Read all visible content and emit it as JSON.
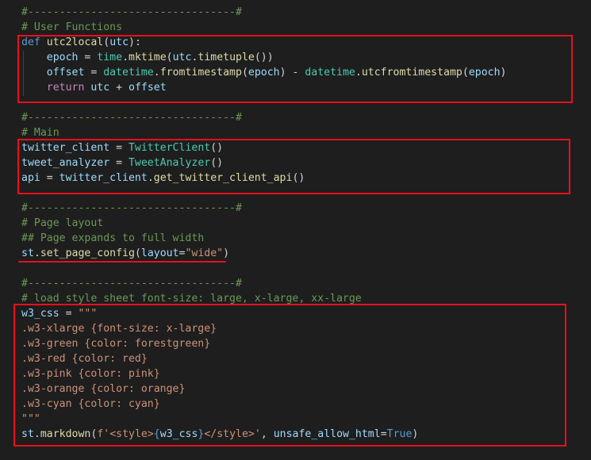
{
  "code": {
    "l1": "#---------------------------------#",
    "l2": "# User Functions",
    "l3a": "def",
    "l3b": " utc2local",
    "l3c": "(",
    "l3d": "utc",
    "l3e": "):",
    "l4a": "    epoch",
    "l4b": " = ",
    "l4c": "time",
    "l4d": ".",
    "l4e": "mktime",
    "l4f": "(",
    "l4g": "utc",
    "l4h": ".",
    "l4i": "timetuple",
    "l4j": "())",
    "l5a": "    offset",
    "l5b": " = ",
    "l5c": "datetime",
    "l5d": ".",
    "l5e": "fromtimestamp",
    "l5f": "(",
    "l5g": "epoch",
    "l5h": ") - ",
    "l5i": "datetime",
    "l5j": ".",
    "l5k": "utcfromtimestamp",
    "l5l": "(",
    "l5m": "epoch",
    "l5n": ")",
    "l6a": "    return",
    "l6b": " utc",
    "l6c": " + ",
    "l6d": "offset",
    "l7": "#---------------------------------#",
    "l8": "# Main",
    "l9a": "twitter_client",
    "l9b": " = ",
    "l9c": "TwitterClient",
    "l9d": "()",
    "l10a": "tweet_analyzer",
    "l10b": " = ",
    "l10c": "TweetAnalyzer",
    "l10d": "()",
    "l11a": "api",
    "l11b": " = ",
    "l11c": "twitter_client",
    "l11d": ".",
    "l11e": "get_twitter_client_api",
    "l11f": "()",
    "l12": "#---------------------------------#",
    "l13": "# Page layout",
    "l14": "## Page expands to full width",
    "l15a": "st",
    "l15b": ".",
    "l15c": "set_page_config",
    "l15d": "(",
    "l15e": "layout",
    "l15f": "=",
    "l15g": "\"wide\"",
    "l15h": ")",
    "l16": "#---------------------------------#",
    "l17": "# load style sheet font-size: large, x-large, xx-large",
    "l18a": "w3_css",
    "l18b": " = ",
    "l18c": "\"\"\"",
    "l19": ".w3-xlarge {font-size: x-large}",
    "l20": ".w3-green {color: forestgreen}",
    "l21": ".w3-red {color: red}",
    "l22": ".w3-pink {color: pink}",
    "l23": ".w3-orange {color: orange}",
    "l24": ".w3-cyan {color: cyan}",
    "l25": "\"\"\"",
    "l26a": "st",
    "l26b": ".",
    "l26c": "markdown",
    "l26d": "(",
    "l26e": "f'<style>",
    "l26f": "{",
    "l26g": "w3_css",
    "l26h": "}",
    "l26i": "</style>'",
    "l26j": ", ",
    "l26k": "unsafe_allow_html",
    "l26l": "=",
    "l26m": "True",
    "l26n": ")"
  },
  "highlight_color": "#e8101b"
}
